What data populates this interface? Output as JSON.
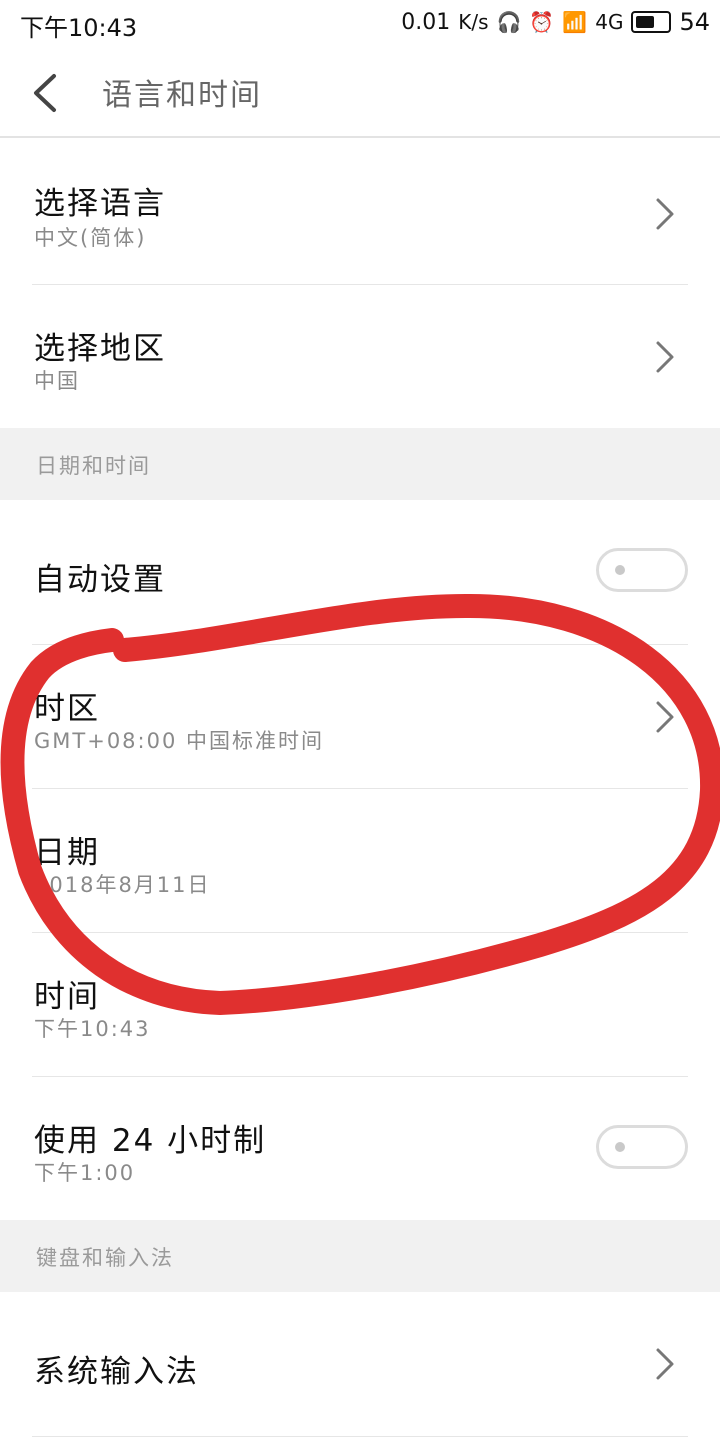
{
  "status": {
    "time": "下午10:43",
    "speed": "0.01",
    "speed_unit": "K/s",
    "network": "4G",
    "battery": "54"
  },
  "header": {
    "title": "语言和时间"
  },
  "sections": {
    "language": {
      "items": [
        {
          "title": "选择语言",
          "value": "中文(简体)"
        },
        {
          "title": "选择地区",
          "value": "中国"
        }
      ]
    },
    "datetime": {
      "header": "日期和时间",
      "auto_label": "自动设置",
      "timezone": {
        "title": "时区",
        "value": "GMT+08:00 中国标准时间"
      },
      "date": {
        "title": "日期",
        "value": "2018年8月11日"
      },
      "time": {
        "title": "时间",
        "value": "下午10:43"
      },
      "h24": {
        "title": "使用 24 小时制",
        "value": "下午1:00"
      }
    },
    "keyboard": {
      "header": "键盘和输入法",
      "items": [
        {
          "title": "系统输入法"
        }
      ]
    }
  },
  "annotations": {
    "circle_color": "#e0302f"
  }
}
